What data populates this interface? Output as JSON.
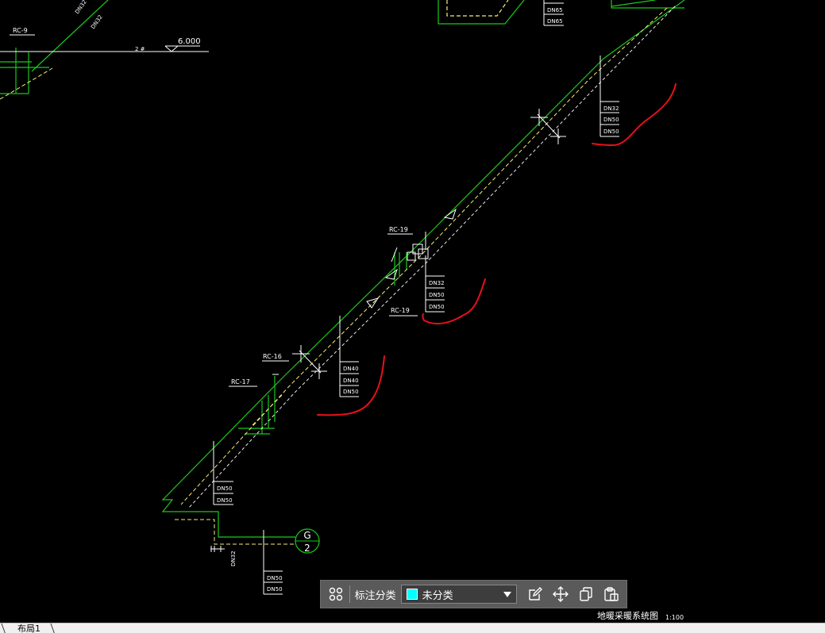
{
  "drawing": {
    "title": "地暖采暖系统图",
    "scale": "1:100",
    "level_mark": "6.000",
    "axis_letter": "G",
    "axis_number": "2",
    "pipe_labels": {
      "rc9": "RC-9",
      "rc16": "RC-16",
      "rc17": "RC-17",
      "rc19_top": "RC-19",
      "rc19_bottom": "RC-19"
    },
    "dn_top_left_a": "DN32",
    "dn_top_left_b": "DN32",
    "dn_top_right": [
      "DN65",
      "DN65"
    ],
    "dn_upper": [
      "DN32",
      "DN50",
      "DN50"
    ],
    "dn_mid": [
      "DN32",
      "DN50",
      "DN50"
    ],
    "dn_low": [
      "DN40",
      "DN40",
      "DN50"
    ],
    "dn_bottom_a": [
      "DN50",
      "DN50"
    ],
    "dn_bottom_b": [
      "DN50",
      "DN50"
    ],
    "dn_vertical": "DN32",
    "dim_tag": "2 #"
  },
  "toolbar": {
    "label": "标注分类",
    "selected": "未分类",
    "swatch_color": "#00ffff"
  },
  "tabs": {
    "layout1": "布局1"
  },
  "colors": {
    "pipe_green": "#19c919",
    "dashed_yellow": "#f2ee7a",
    "markup_red": "#e8101a",
    "white": "#ffffff"
  }
}
